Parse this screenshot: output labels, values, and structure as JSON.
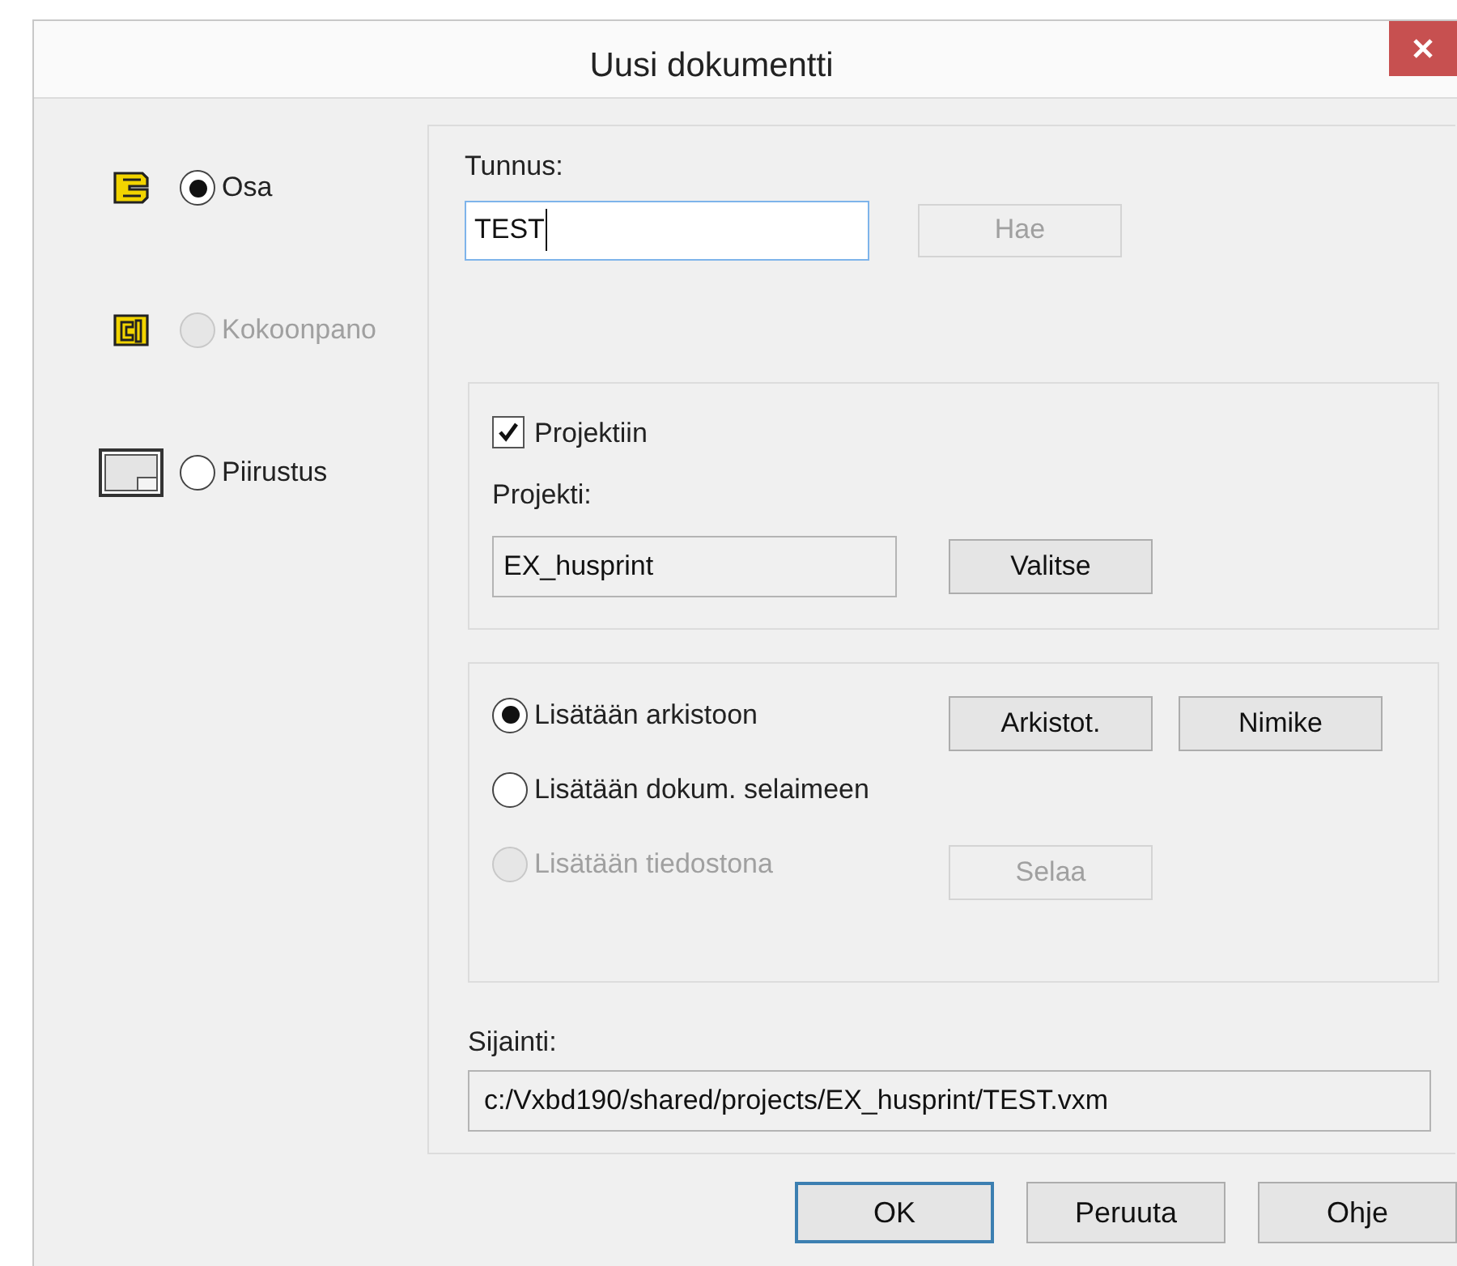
{
  "window": {
    "title": "Uusi dokumentti"
  },
  "doc_types": [
    {
      "kind": "part",
      "label": "Osa",
      "selected": true,
      "disabled": false
    },
    {
      "kind": "assembly",
      "label": "Kokoonpano",
      "selected": false,
      "disabled": true
    },
    {
      "kind": "drawing",
      "label": "Piirustus",
      "selected": false,
      "disabled": false
    }
  ],
  "identifier": {
    "label": "Tunnus:",
    "value": "TEST",
    "focused": true
  },
  "fetch_button": {
    "label": "Hae",
    "disabled": true
  },
  "project_group": {
    "checkbox": {
      "label": "Projektiin",
      "checked": true
    },
    "project_label": "Projekti:",
    "project_value": "EX_husprint",
    "choose_button": "Valitse"
  },
  "storage_options": [
    {
      "label": "Lisätään arkistoon",
      "selected": true,
      "disabled": false,
      "buttons": [
        {
          "label": "Arkistot.",
          "disabled": false
        },
        {
          "label": "Nimike",
          "disabled": false
        }
      ]
    },
    {
      "label": "Lisätään dokum. selaimeen",
      "selected": false,
      "disabled": false
    },
    {
      "label": "Lisätään tiedostona",
      "selected": false,
      "disabled": true,
      "buttons": [
        {
          "label": "Selaa",
          "disabled": true
        }
      ]
    }
  ],
  "location": {
    "label": "Sijainti:",
    "value": "c:/Vxbd190/shared/projects/EX_husprint/TEST.vxm"
  },
  "buttons": [
    {
      "label": "OK",
      "default": true
    },
    {
      "label": "Peruuta",
      "default": false
    },
    {
      "label": "Ohje",
      "default": false
    }
  ]
}
